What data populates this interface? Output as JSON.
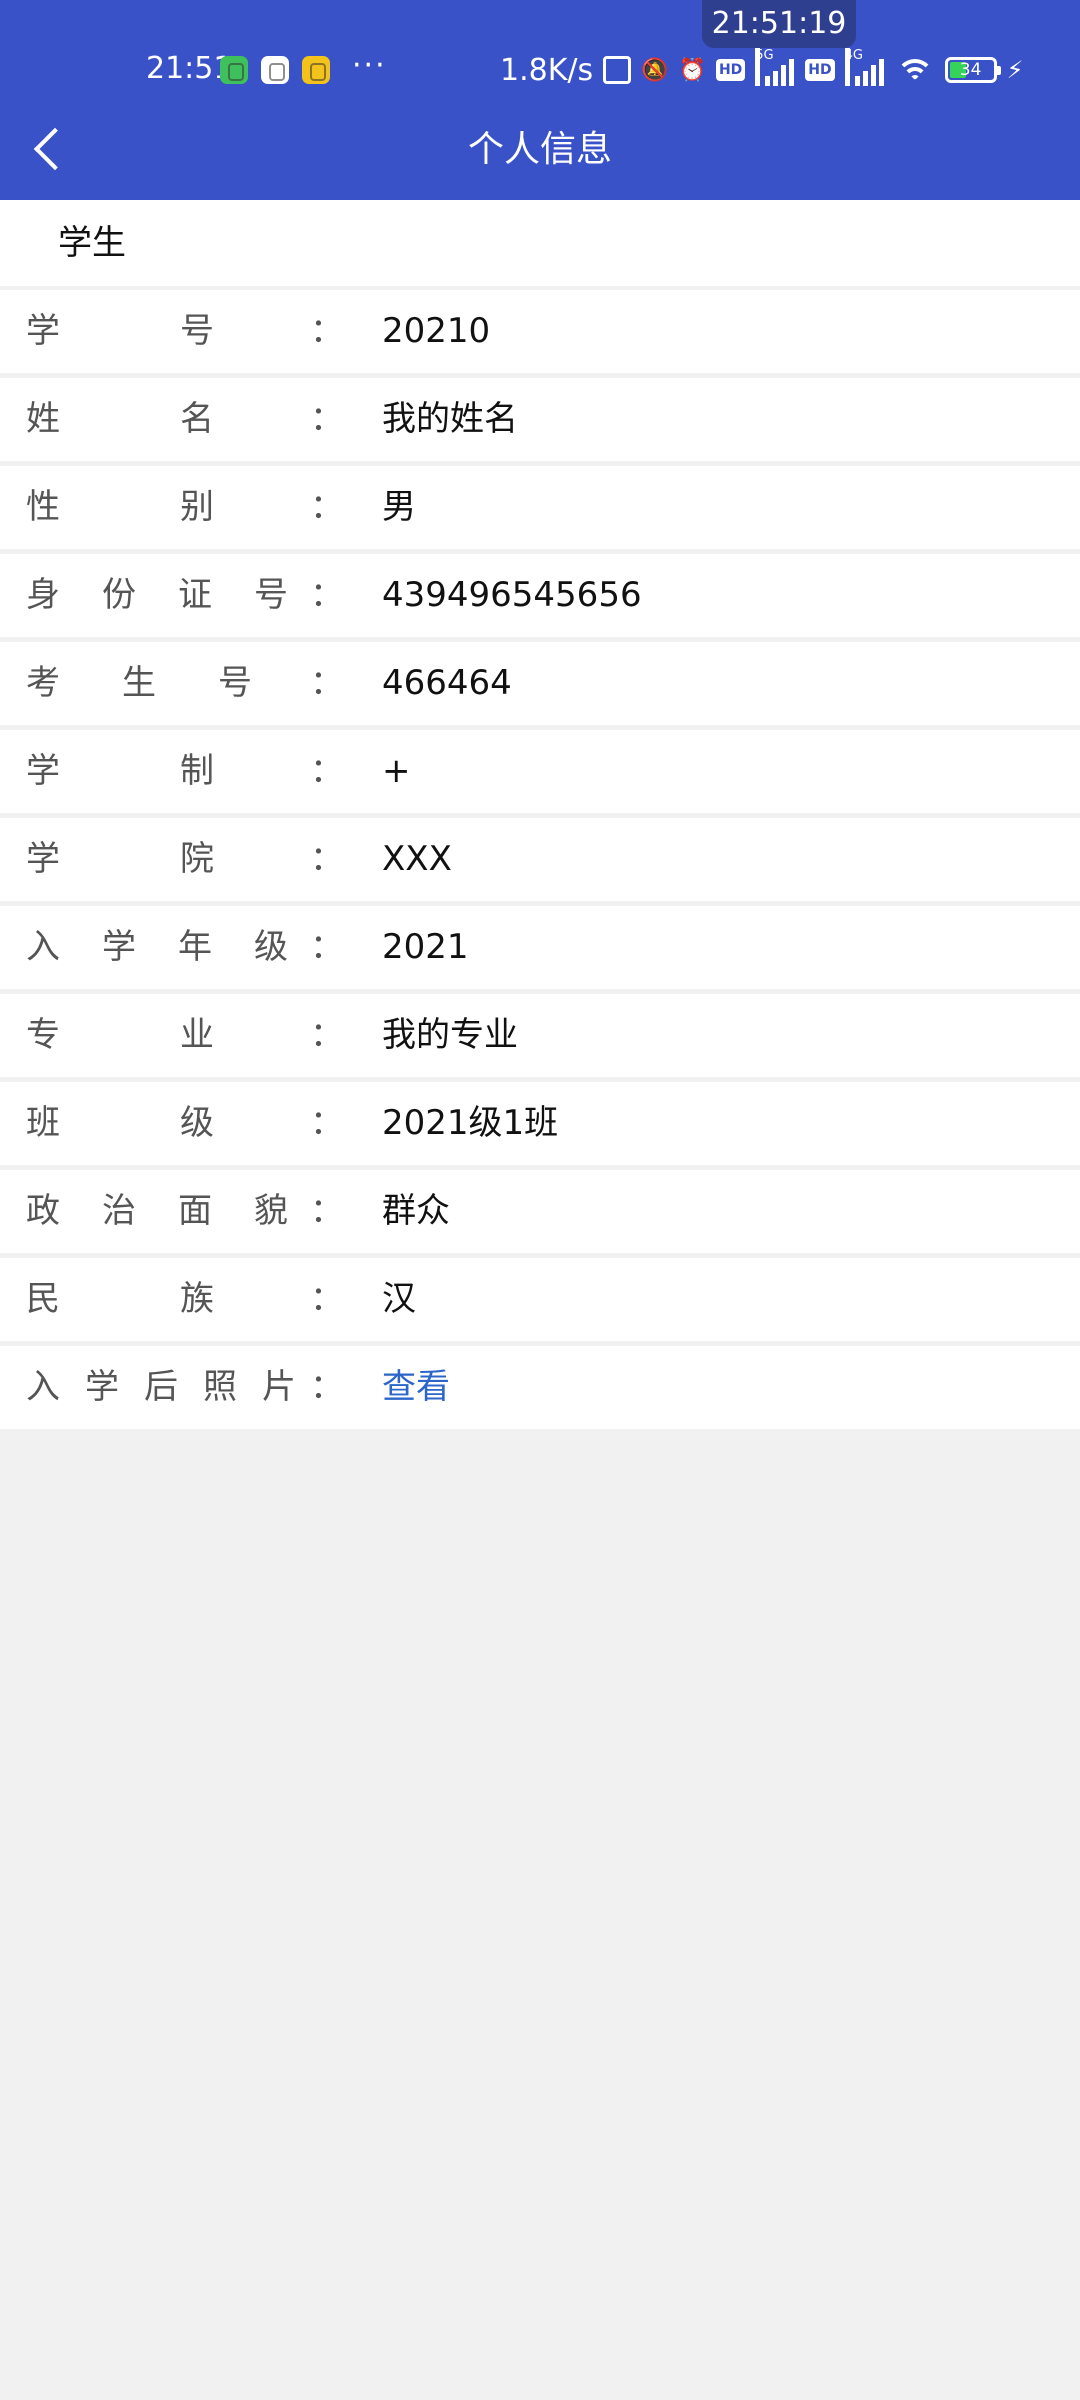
{
  "status_bar": {
    "clock_pill": "21:51:19",
    "time": "21:51",
    "more": "···",
    "net_speed": "1.8K/s",
    "network_1": "5G",
    "network_2": "4G",
    "hd": "HD",
    "battery": "34",
    "colors": {
      "header_bg": "#3a52c8",
      "battery_fill": "#35d35a"
    }
  },
  "nav": {
    "title": "个人信息"
  },
  "section": {
    "title": "学生"
  },
  "info_rows": [
    {
      "label": [
        "学",
        "号"
      ],
      "value": "20210"
    },
    {
      "label": [
        "姓",
        "名"
      ],
      "value": "我的姓名"
    },
    {
      "label": [
        "性",
        "别"
      ],
      "value": "男"
    },
    {
      "label": [
        "身",
        "份",
        "证",
        "号"
      ],
      "value": "439496545656"
    },
    {
      "label": [
        "考",
        "生",
        "号"
      ],
      "value": "466464"
    },
    {
      "label": [
        "学",
        "制"
      ],
      "value": "+"
    },
    {
      "label": [
        "学",
        "院"
      ],
      "value": "XXX"
    },
    {
      "label": [
        "入",
        "学",
        "年",
        "级"
      ],
      "value": "2021"
    },
    {
      "label": [
        "专",
        "业"
      ],
      "value": "我的专业"
    },
    {
      "label": [
        "班",
        "级"
      ],
      "value": "2021级1班"
    },
    {
      "label": [
        "政",
        "治",
        "面",
        "貌"
      ],
      "value": "群众"
    },
    {
      "label": [
        "民",
        "族"
      ],
      "value": "汉"
    },
    {
      "label": [
        "入",
        "学",
        "后",
        "照",
        "片"
      ],
      "value": "查看",
      "link": true
    }
  ],
  "colon": "：",
  "link_color": "#2c66c8"
}
